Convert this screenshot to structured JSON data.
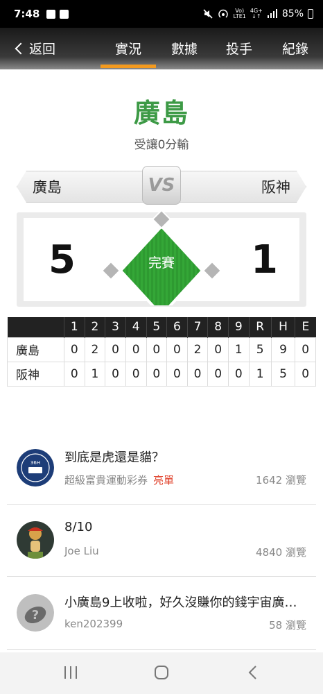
{
  "status_bar": {
    "time": "7:48",
    "signal_text": "Vo) 4G+\nLTE1",
    "battery": "85%"
  },
  "nav": {
    "back_label": "返回",
    "tabs": [
      {
        "label": "實況",
        "active": true
      },
      {
        "label": "數據",
        "active": false
      },
      {
        "label": "投手",
        "active": false
      },
      {
        "label": "紀錄",
        "active": false
      }
    ]
  },
  "game": {
    "winner": "廣島",
    "result_subtitle": "受讓0分輸",
    "away_team": "廣島",
    "home_team": "阪神",
    "vs_label": "VS",
    "away_score": "5",
    "home_score": "1",
    "status": "完賽"
  },
  "linescore": {
    "headers": [
      "1",
      "2",
      "3",
      "4",
      "5",
      "6",
      "7",
      "8",
      "9",
      "R",
      "H",
      "E"
    ],
    "rows": [
      {
        "team": "廣島",
        "cells": [
          "0",
          "2",
          "0",
          "0",
          "0",
          "0",
          "2",
          "0",
          "1",
          "5",
          "9",
          "0"
        ]
      },
      {
        "team": "阪神",
        "cells": [
          "0",
          "1",
          "0",
          "0",
          "0",
          "0",
          "0",
          "0",
          "0",
          "1",
          "5",
          "0"
        ]
      }
    ]
  },
  "posts": [
    {
      "title": "到底是虎還是貓？",
      "author": "超級富貴運動彩券",
      "tag": "亮單",
      "views": "1642 瀏覽",
      "avatar": "lottery-logo-icon"
    },
    {
      "title": "8/10",
      "author": "Joe Liu",
      "tag": "",
      "views": "4840 瀏覽",
      "avatar": "baseball-mascot-icon"
    },
    {
      "title": "小廣島9上收啦，好久沒賺你的錢宇宙廣…",
      "author": "ken202399",
      "tag": "",
      "views": "58 瀏覽",
      "avatar": "unknown-user-icon"
    }
  ],
  "colors": {
    "accent": "#f39a1f",
    "win_green": "#3d9a46",
    "field_green": "#34a737",
    "tag_red": "#e0402a"
  }
}
